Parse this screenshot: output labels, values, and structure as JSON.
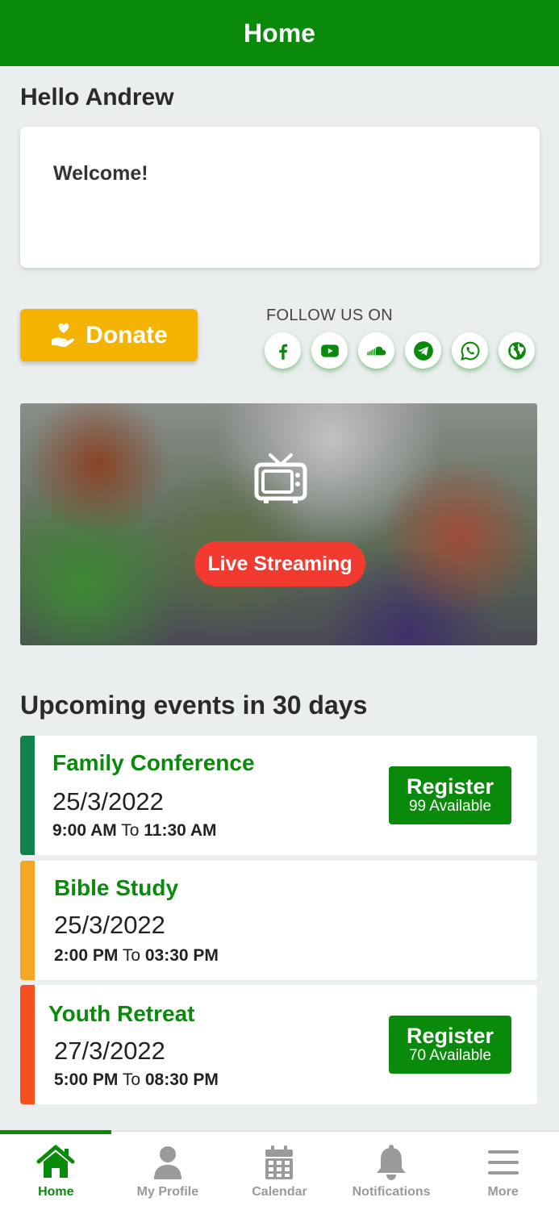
{
  "header": {
    "title": "Home"
  },
  "greeting": "Hello Andrew",
  "welcome_card": {
    "text": "Welcome!"
  },
  "donate": {
    "label": "Donate",
    "icon": "donate-hand-heart-icon",
    "color": "#f5b301"
  },
  "follow": {
    "label": "FOLLOW US ON",
    "icons": [
      "facebook-icon",
      "youtube-icon",
      "soundcloud-icon",
      "telegram-icon",
      "whatsapp-icon",
      "globe-icon"
    ]
  },
  "live": {
    "label": "Live Streaming",
    "icon": "tv-icon",
    "color": "#f23a30"
  },
  "events": {
    "heading": "Upcoming events in 30 days",
    "items": [
      {
        "title": "Family Conference",
        "date": "25/3/2022",
        "start": "9:00 AM",
        "to": "To",
        "end": "11:30 AM",
        "bar_color": "#10834a",
        "register_label": "Register",
        "available": "99 Available"
      },
      {
        "title": "Bible Study",
        "date": "25/3/2022",
        "start": "2:00 PM",
        "to": "To",
        "end": "03:30 PM",
        "bar_color": "#f5a623"
      },
      {
        "title": "Youth Retreat",
        "date": "27/3/2022",
        "start": "5:00 PM",
        "to": "To",
        "end": "08:30 PM",
        "bar_color": "#f4511e",
        "register_label": "Register",
        "available": "70 Available"
      }
    ]
  },
  "nav": {
    "items": [
      {
        "label": "Home",
        "icon": "home-icon"
      },
      {
        "label": "My Profile",
        "icon": "user-icon"
      },
      {
        "label": "Calendar",
        "icon": "calendar-icon"
      },
      {
        "label": "Notifications",
        "icon": "bell-icon"
      },
      {
        "label": "More",
        "icon": "menu-icon"
      }
    ]
  },
  "colors": {
    "brand": "#0a8a0a",
    "background": "#eaeeee"
  }
}
